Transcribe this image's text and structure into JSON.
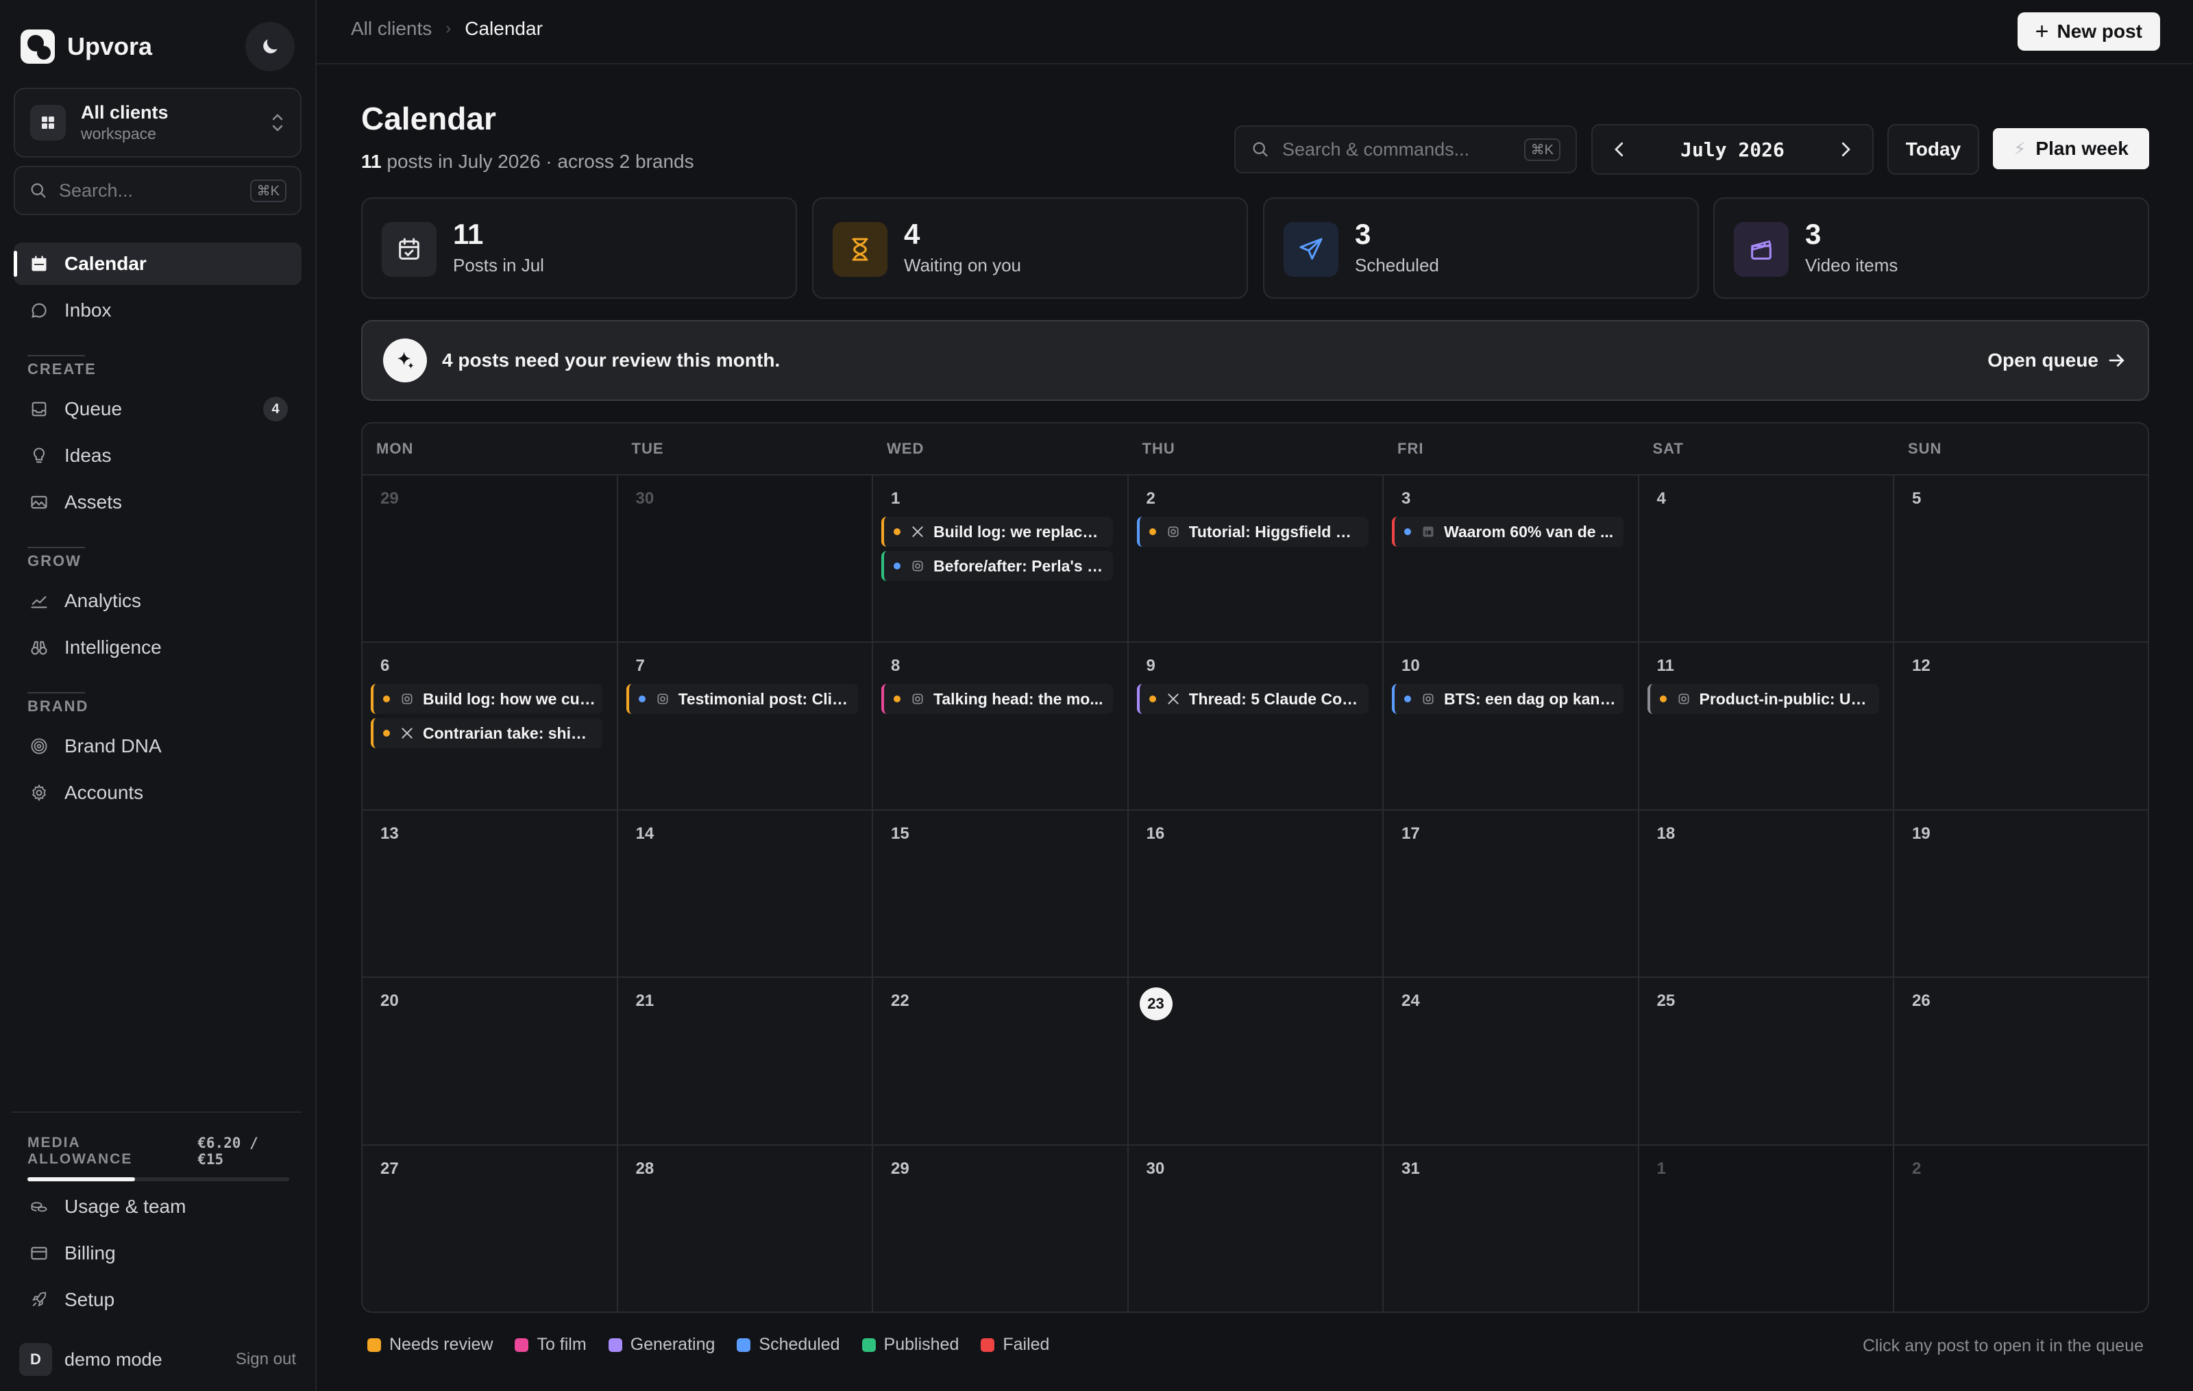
{
  "app": {
    "name": "Upvora"
  },
  "workspace": {
    "title": "All clients",
    "subtitle": "workspace"
  },
  "sidebar_search": {
    "placeholder": "Search...",
    "shortcut": "⌘K"
  },
  "nav": {
    "calendar": "Calendar",
    "inbox": "Inbox",
    "create_label": "CREATE",
    "queue": "Queue",
    "queue_badge": "4",
    "ideas": "Ideas",
    "assets": "Assets",
    "grow_label": "GROW",
    "analytics": "Analytics",
    "intelligence": "Intelligence",
    "brand_label": "BRAND",
    "brand_dna": "Brand DNA",
    "accounts": "Accounts"
  },
  "allowance": {
    "label": "MEDIA ALLOWANCE",
    "value": "€6.20 / €15",
    "fraction": 0.41
  },
  "footer_nav": {
    "usage": "Usage & team",
    "billing": "Billing",
    "setup": "Setup"
  },
  "user": {
    "initial": "D",
    "name": "demo mode",
    "signout": "Sign out"
  },
  "breadcrumb": {
    "parent": "All clients",
    "current": "Calendar"
  },
  "toolbar": {
    "new_post": "New post",
    "search_placeholder": "Search & commands...",
    "search_shortcut": "⌘K",
    "month": "July 2026",
    "today": "Today",
    "plan_week": "Plan week"
  },
  "page": {
    "title": "Calendar",
    "count": "11",
    "subtitle_rest": "posts in July 2026 · across 2 brands"
  },
  "stats": [
    {
      "value": "11",
      "label": "Posts in Jul",
      "icon": "calendar-check-icon",
      "bg": "#26272c",
      "color": "#e8e8ea"
    },
    {
      "value": "4",
      "label": "Waiting on you",
      "icon": "hourglass-icon",
      "bg": "#3a2d14",
      "color": "#f5a623"
    },
    {
      "value": "3",
      "label": "Scheduled",
      "icon": "send-icon",
      "bg": "#1d2636",
      "color": "#5b9dff"
    },
    {
      "value": "3",
      "label": "Video items",
      "icon": "clapperboard-icon",
      "bg": "#2a2438",
      "color": "#a78bfa"
    }
  ],
  "banner": {
    "text": "4 posts need your review this month.",
    "link": "Open queue"
  },
  "calendar": {
    "weekdays": [
      "MON",
      "TUE",
      "WED",
      "THU",
      "FRI",
      "SAT",
      "SUN"
    ],
    "weeks": [
      [
        {
          "d": "29",
          "out": true
        },
        {
          "d": "30",
          "out": true
        },
        {
          "d": "1"
        },
        {
          "d": "2"
        },
        {
          "d": "3"
        },
        {
          "d": "4"
        },
        {
          "d": "5"
        }
      ],
      [
        {
          "d": "6"
        },
        {
          "d": "7"
        },
        {
          "d": "8"
        },
        {
          "d": "9"
        },
        {
          "d": "10"
        },
        {
          "d": "11"
        },
        {
          "d": "12"
        }
      ],
      [
        {
          "d": "13"
        },
        {
          "d": "14"
        },
        {
          "d": "15"
        },
        {
          "d": "16"
        },
        {
          "d": "17"
        },
        {
          "d": "18"
        },
        {
          "d": "19"
        }
      ],
      [
        {
          "d": "20"
        },
        {
          "d": "21"
        },
        {
          "d": "22"
        },
        {
          "d": "23",
          "today": true
        },
        {
          "d": "24"
        },
        {
          "d": "25"
        },
        {
          "d": "26"
        }
      ],
      [
        {
          "d": "27"
        },
        {
          "d": "28"
        },
        {
          "d": "29"
        },
        {
          "d": "30"
        },
        {
          "d": "31"
        },
        {
          "d": "1",
          "out": true
        },
        {
          "d": "2",
          "out": true
        }
      ]
    ],
    "posts": [
      {
        "week": 0,
        "day": 2,
        "slot": 0,
        "text": "Build log: we replaced ...",
        "platform": "x-icon",
        "status": "needs-review",
        "bar": "#f5a623",
        "dot": "#f5a623"
      },
      {
        "week": 0,
        "day": 2,
        "slot": 1,
        "text": "Before/after: Perla's o...",
        "platform": "instagram-icon",
        "status": "published",
        "bar": "#2ec27e",
        "dot": "#5b9dff"
      },
      {
        "week": 0,
        "day": 3,
        "slot": 0,
        "text": "Tutorial: Higgsfield Do...",
        "platform": "instagram-icon",
        "status": "scheduled",
        "bar": "#5b9dff",
        "dot": "#f5a623"
      },
      {
        "week": 0,
        "day": 4,
        "slot": 0,
        "text": "Waarom 60% van de ...",
        "platform": "linkedin-icon",
        "status": "failed",
        "bar": "#ef4444",
        "dot": "#5b9dff"
      },
      {
        "week": 1,
        "day": 0,
        "slot": 0,
        "text": "Build log: how we cut ...",
        "platform": "instagram-icon",
        "status": "needs-review",
        "bar": "#f5a623",
        "dot": "#f5a623"
      },
      {
        "week": 1,
        "day": 0,
        "slot": 1,
        "text": "Contrarian take: shipp...",
        "platform": "x-icon",
        "status": "needs-review",
        "bar": "#f5a623",
        "dot": "#f5a623"
      },
      {
        "week": 1,
        "day": 1,
        "slot": 0,
        "text": "Testimonial post: Clini...",
        "platform": "instagram-icon",
        "status": "needs-review",
        "bar": "#f5a623",
        "dot": "#5b9dff"
      },
      {
        "week": 1,
        "day": 2,
        "slot": 0,
        "text": "Talking head: the mo...",
        "platform": "instagram-icon",
        "status": "to-film",
        "bar": "#ec4899",
        "dot": "#f5a623"
      },
      {
        "week": 1,
        "day": 3,
        "slot": 0,
        "text": "Thread: 5 Claude Cod...",
        "platform": "x-icon",
        "status": "generating",
        "bar": "#a78bfa",
        "dot": "#f5a623"
      },
      {
        "week": 1,
        "day": 4,
        "slot": 0,
        "text": "BTS: een dag op kanto...",
        "platform": "instagram-icon",
        "status": "scheduled",
        "bar": "#5b9dff",
        "dot": "#5b9dff"
      },
      {
        "week": 1,
        "day": 5,
        "slot": 0,
        "text": "Product-in-public: Up...",
        "platform": "instagram-icon",
        "status": "other",
        "bar": "#8c8d94",
        "dot": "#f5a623"
      }
    ]
  },
  "legend": [
    {
      "label": "Needs review",
      "color": "#f5a623"
    },
    {
      "label": "To film",
      "color": "#ec4899"
    },
    {
      "label": "Generating",
      "color": "#a78bfa"
    },
    {
      "label": "Scheduled",
      "color": "#5b9dff"
    },
    {
      "label": "Published",
      "color": "#2ec27e"
    },
    {
      "label": "Failed",
      "color": "#ef4444"
    }
  ],
  "hint": "Click any post to open it in the queue"
}
